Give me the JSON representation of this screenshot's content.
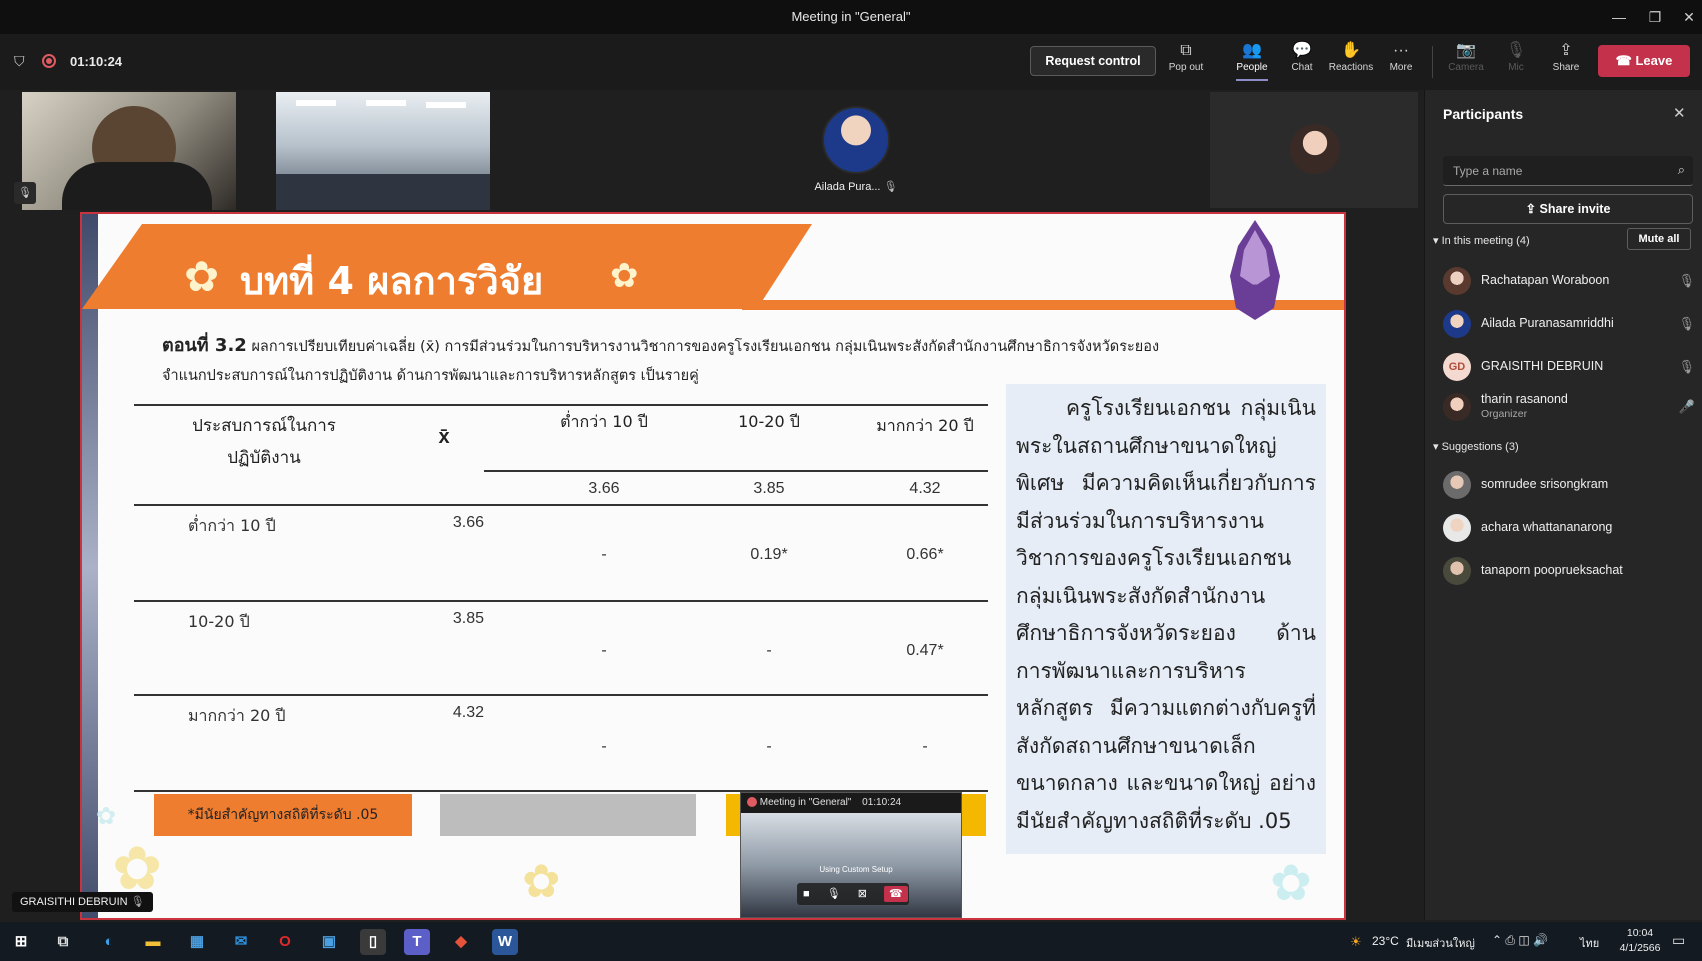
{
  "window": {
    "title": "Meeting in \"General\""
  },
  "toolbar": {
    "timer": "01:10:24",
    "request_control": "Request control",
    "pop_out": "Pop out",
    "people": "People",
    "chat": "Chat",
    "reactions": "Reactions",
    "more": "More",
    "camera": "Camera",
    "mic": "Mic",
    "share": "Share",
    "leave": "Leave"
  },
  "video_tiles": {
    "ailada_label": "Ailada Pura...",
    "bottom_name_tag": "GRAISITHI DEBRUIN"
  },
  "slide": {
    "heading": "บทที่ 4 ผลการวิจัย",
    "section_label": "ตอนที่ 3.2",
    "description_line1": "ผลการเปรียบเทียบค่าเฉลี่ย (x̄) การมีส่วนร่วมในการบริหารงานวิชาการของครูโรงเรียนเอกชน กลุ่มเนินพระสังกัดสำนักงานศึกษาธิการจังหวัดระยอง",
    "description_line2": "จำแนกประสบการณ์ในการปฏิบัติงาน ด้านการพัฒนาและการบริหารหลักสูตร เป็นรายคู่",
    "table": {
      "header_experience": "ประสบการณ์ในการ ปฏิบัติงาน",
      "header_mean": "x̄",
      "col_headers": [
        "ต่ำกว่า 10 ปี",
        "10-20 ปี",
        "มากกว่า 20 ปี"
      ],
      "col_means": [
        "3.66",
        "3.85",
        "4.32"
      ],
      "rows": [
        {
          "label": "ต่ำกว่า 10 ปี",
          "mean": "3.66",
          "cells": [
            "-",
            "0.19*",
            "0.66*"
          ]
        },
        {
          "label": "10-20 ปี",
          "mean": "3.85",
          "cells": [
            "-",
            "-",
            "0.47*"
          ]
        },
        {
          "label": "มากกว่า 20 ปี",
          "mean": "4.32",
          "cells": [
            "-",
            "-",
            "-"
          ]
        }
      ],
      "footnote": "*มีนัยสำคัญทางสถิติที่ระดับ .05"
    },
    "summary": "ครูโรงเรียนเอกชน กลุ่มเนินพระในสถานศึกษาขนาดใหญ่พิเศษ มีความคิดเห็นเกี่ยวกับการมีส่วนร่วมในการบริหารงานวิชาการของครูโรงเรียนเอกชนกลุ่มเนินพระสังกัดสำนักงานศึกษาธิการจังหวัดระยอง ด้านการพัฒนาและการบริหารหลักสูตร มีความแตกต่างกับครูที่สังกัดสถานศึกษาขนาดเล็ก ขนาดกลาง และขนาดใหญ่ อย่างมีนัยสำคัญทางสถิติที่ระดับ .05"
  },
  "mini_window": {
    "title": "Meeting in \"General\"",
    "time": "01:10:24",
    "setup_label": "Using Custom Setup"
  },
  "panel": {
    "title": "Participants",
    "search_placeholder": "Type a name",
    "share_invite": "Share invite",
    "in_meeting_label": "In this meeting (4)",
    "mute_all": "Mute all",
    "participants": [
      {
        "name": "Rachatapan Woraboon",
        "role": ""
      },
      {
        "name": "Ailada Puranasamriddhi",
        "role": ""
      },
      {
        "name": "GRAISITHI DEBRUIN",
        "role": "",
        "initials": "GD"
      },
      {
        "name": "tharin rasanond",
        "role": "Organizer"
      }
    ],
    "suggestions_label": "Suggestions (3)",
    "suggestions": [
      {
        "name": "somrudee srisongkram"
      },
      {
        "name": "achara whattananarong"
      },
      {
        "name": "tanaporn pooprueksachat"
      }
    ]
  },
  "taskbar": {
    "weather": "23°C",
    "weather_text": "มีเมฆส่วนใหญ่",
    "lang": "ไทย",
    "time": "10:04",
    "date": "4/1/2566"
  }
}
